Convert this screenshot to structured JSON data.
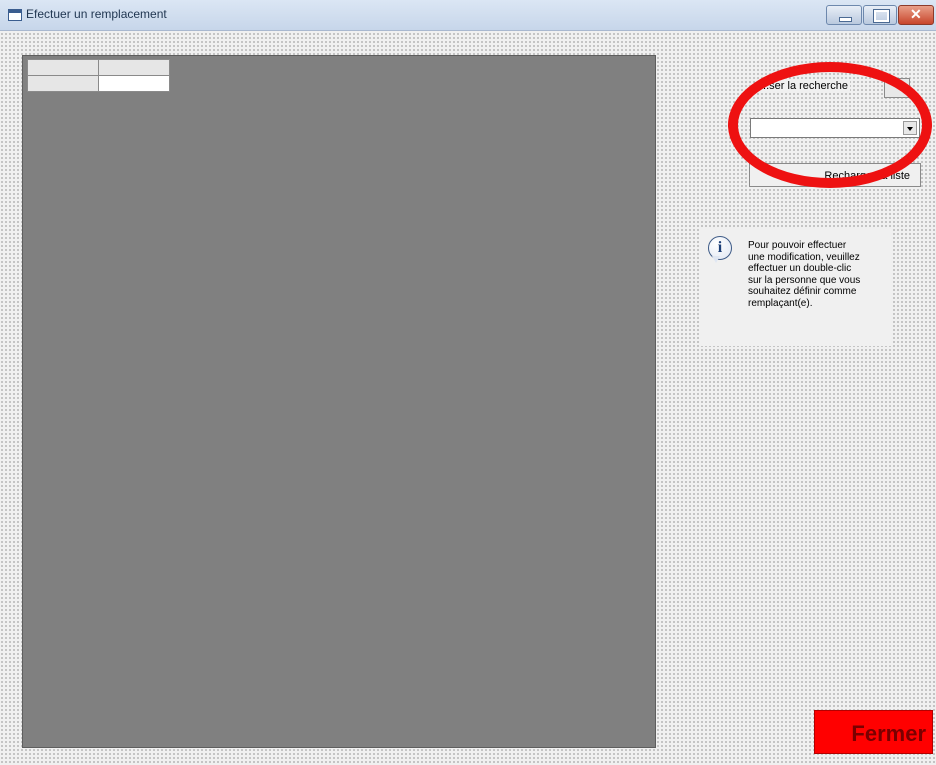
{
  "window": {
    "title": "Efectuer un remplacement"
  },
  "grid": {
    "rows": [
      [
        "",
        ""
      ],
      [
        "",
        ""
      ]
    ]
  },
  "controls": {
    "search_label": "...ser la recherche",
    "search_button_label": "",
    "combo_value": "",
    "reload_button_label": "Recharger la liste",
    "highlight_color": "#ee1111"
  },
  "info": {
    "icon": "info-icon",
    "text": "Pour pouvoir effectuer\nune modification, veuillez\neffectuer un double-clic\nsur la personne que vous\nsouhaitez définir comme\nremplaçant(e)."
  },
  "footer": {
    "close_label": "Fermer",
    "close_color": "#ff0000"
  }
}
